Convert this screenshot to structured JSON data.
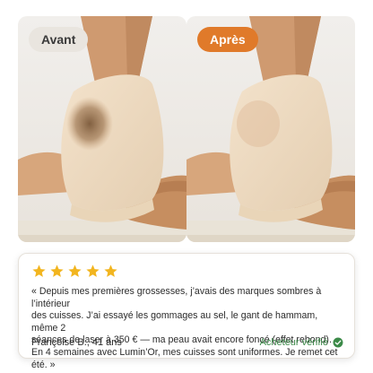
{
  "before": {
    "label": "Avant"
  },
  "after": {
    "label": "Après"
  },
  "review": {
    "rating": 5,
    "text": "« Depuis mes premières grossesses, j’avais des marques sombres à l’intérieur\ndes cuisses. J’ai essayé les gommages au sel, le gant de hammam, même 2\nséances de laser à 350 € — ma peau avait encore foncé (effet rebond).\nEn 4 semaines avec Lumin’Or, mes cuisses sont uniformes. Je remet cet été. »",
    "author": "Françoise B., 41 ans",
    "verified": "Acheteur vérifié"
  },
  "colors": {
    "star": "#f2b51f",
    "badge_before": "#e9e5df",
    "badge_after": "#e07a2a",
    "verified": "#3b8a48"
  }
}
